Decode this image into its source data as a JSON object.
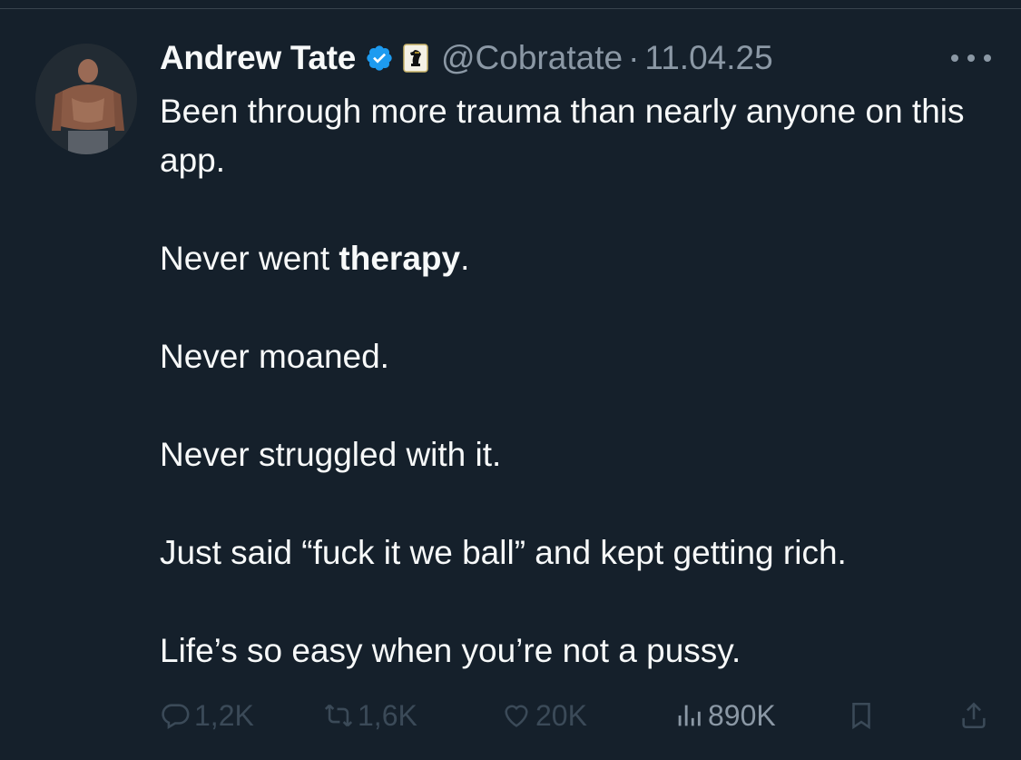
{
  "author": {
    "display_name": "Andrew Tate",
    "handle": "@Cobratate",
    "separator": "·",
    "timestamp": "11.04.25"
  },
  "icons": {
    "verified": "verified-badge-icon",
    "affiliate": "knight-affiliate-icon",
    "more": "more-options-icon",
    "reply": "reply-icon",
    "retweet": "retweet-icon",
    "like": "like-heart-icon",
    "views": "views-chart-icon",
    "bookmark": "bookmark-icon",
    "share": "share-icon"
  },
  "tweet": {
    "line1": "Been through more trauma than nearly anyone on this app.",
    "line2_prefix": "Never went ",
    "line2_bold": "therapy",
    "line2_suffix": ".",
    "line3": "Never moaned.",
    "line4": "Never struggled with it.",
    "line5": "Just said “fuck it we ball” and kept getting rich.",
    "line6": "Life’s so easy when you’re not a pussy."
  },
  "stats": {
    "replies": "1,2K",
    "retweets": "1,6K",
    "likes": "20K",
    "views": "890K"
  },
  "colors": {
    "background": "#15202b",
    "text": "#f7f9f9",
    "secondary": "#8b98a5",
    "muted": "#3b4a58",
    "verified": "#1d9bf0"
  }
}
